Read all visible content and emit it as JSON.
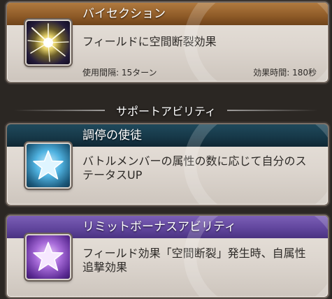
{
  "ability": {
    "name": "バイセクション",
    "description": "フィールドに空間断裂効果",
    "cooldown": "使用間隔: 15ターン",
    "duration": "効果時間: 180秒",
    "icon": "burst-icon"
  },
  "section": {
    "label": "サポートアビリティ"
  },
  "support_abilities": [
    {
      "name": "調停の使徒",
      "description": "バトルメンバーの属性の数に応じて自分のステータスUP",
      "icon": "star-icon",
      "header_color": "#163747"
    },
    {
      "name": "リミットボーナスアビリティ",
      "description": "フィールド効果「空間断裂」発生時、自属性追撃効果",
      "icon": "star-icon",
      "header_color": "#5f449b"
    }
  ],
  "colors": {
    "ability_header": "#8e5a27",
    "background": "#2b2723",
    "card_body": "#e2dcd5"
  }
}
